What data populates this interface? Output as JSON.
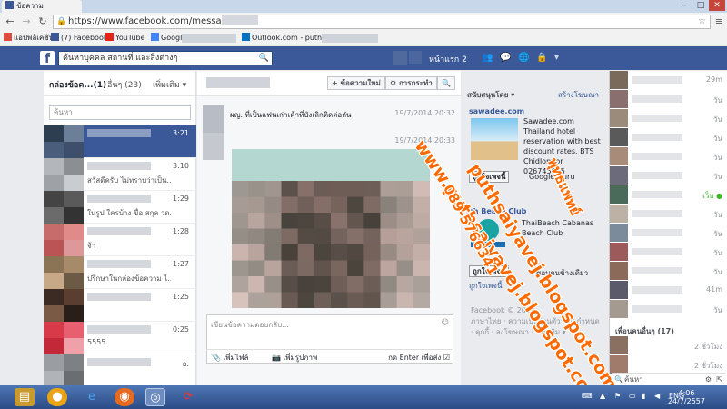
{
  "browser": {
    "tab_title": "ข้อความ",
    "url": "https://www.facebook.com/messa",
    "bookmarks": [
      {
        "label": "แอปพลิเคชัน",
        "color": "#e04a3f"
      },
      {
        "label": "(7) Facebook",
        "color": "#3b5998"
      },
      {
        "label": "YouTube",
        "color": "#e62117"
      },
      {
        "label": "Google",
        "color": "#4285f4"
      },
      {
        "label": "Outlook.com - puth...",
        "color": "#0072c6"
      }
    ]
  },
  "fb": {
    "search_placeholder": "ค้นหาบุคคล สถานที่ และสิ่งต่างๆ",
    "home_label": "หน้าแรก 2"
  },
  "inbox": {
    "tab_inbox": "กล่องข้อค...(1)",
    "tab_other": "อื่นๆ (23)",
    "tab_more": "เพิ่มเติม ▾",
    "search_placeholder": "ค้นหา",
    "conversations": [
      {
        "snippet": "",
        "time": "3:21"
      },
      {
        "snippet": "สวัสดีครับ ไม่ทราบว่าเป็น...",
        "time": "3:10"
      },
      {
        "snippet": "ในรูป ใครบ้าง ขื่อ สกุล วด...",
        "time": "1:29"
      },
      {
        "snippet": "จ้า",
        "time": "1:28"
      },
      {
        "snippet": "ปรึกษาในกล่องข้อความ ไ...",
        "time": "1:27"
      },
      {
        "snippet": "",
        "time": "1:25"
      },
      {
        "snippet": "5555",
        "time": "0:25"
      },
      {
        "snippet": "",
        "time": "อ."
      }
    ]
  },
  "thread": {
    "new_message_btn": "+ ข้อความใหม่",
    "actions_btn": "⚙ การกระทำ",
    "search_btn": "🔍",
    "messages": [
      {
        "text": "ผญ. ที่เป็นแฟนเก่าเค้าที่บังเลิกติดต่อกัน",
        "time": "19/7/2014 20:32"
      },
      {
        "text": "",
        "time": "19/7/2014 20:33"
      }
    ],
    "reply_placeholder": "เขียนข้อความตอบกลับ...",
    "add_file": "เพิ่มไฟล์",
    "add_photo": "เพิ่มรูปภาพ",
    "enter_to_send": "กด Enter เพื่อส่ง"
  },
  "sponsored": {
    "header": "สนับสนุนโดย ▾",
    "create_ad": "สร้างโฆษณา",
    "ad1_title": "sawadee.com",
    "ad1_text": "Sawadee.com Thailand hotel reservation with best discount rates. BTS Chidlom or 026745555",
    "like_label": "ถูกใจเพจนี้",
    "ad1_like_note": "Google Guru",
    "ad2_title": "ch Beach Club",
    "ad2_text": "ThaiBeach Cabanas Beach Club",
    "ad2_note": "ชอบคนข้างเดียว",
    "footer_copy": "Facebook © 2014",
    "footer_links": "ภาษาไทย · ความเป็นส่วนตัว · ข้อกำหนด · คุกกี้ · ลงโฆษณา · เพิ่มเติม ▾"
  },
  "chat": {
    "rows": [
      {
        "time": "29m"
      },
      {
        "time": "วัน"
      },
      {
        "time": "วัน"
      },
      {
        "time": "วัน"
      },
      {
        "time": "วัน"
      },
      {
        "time": "วัน"
      },
      {
        "time": "เว็บ ●"
      },
      {
        "time": "วัน"
      },
      {
        "time": "วัน"
      },
      {
        "time": "วัน"
      },
      {
        "time": "วัน"
      },
      {
        "time": "41m"
      },
      {
        "time": "วัน"
      }
    ],
    "friends_header": "เพื่อนคนอื่นๆ (17)",
    "friends_rows": [
      {
        "time": "2 ชั่วโมง"
      },
      {
        "time": "2 ชั่วโมง"
      }
    ],
    "search_placeholder": "ค้นหา"
  },
  "watermark": {
    "line1": "www.puthsaiyavej.blogspot.com",
    "line2": "puthsaiyavej.blogspot.com",
    "phone1": "089-5766341",
    "phone2": "พุทธแพทย์"
  },
  "taskbar": {
    "lang": "ENG",
    "time": "4:06",
    "date": "24/7/2557"
  }
}
